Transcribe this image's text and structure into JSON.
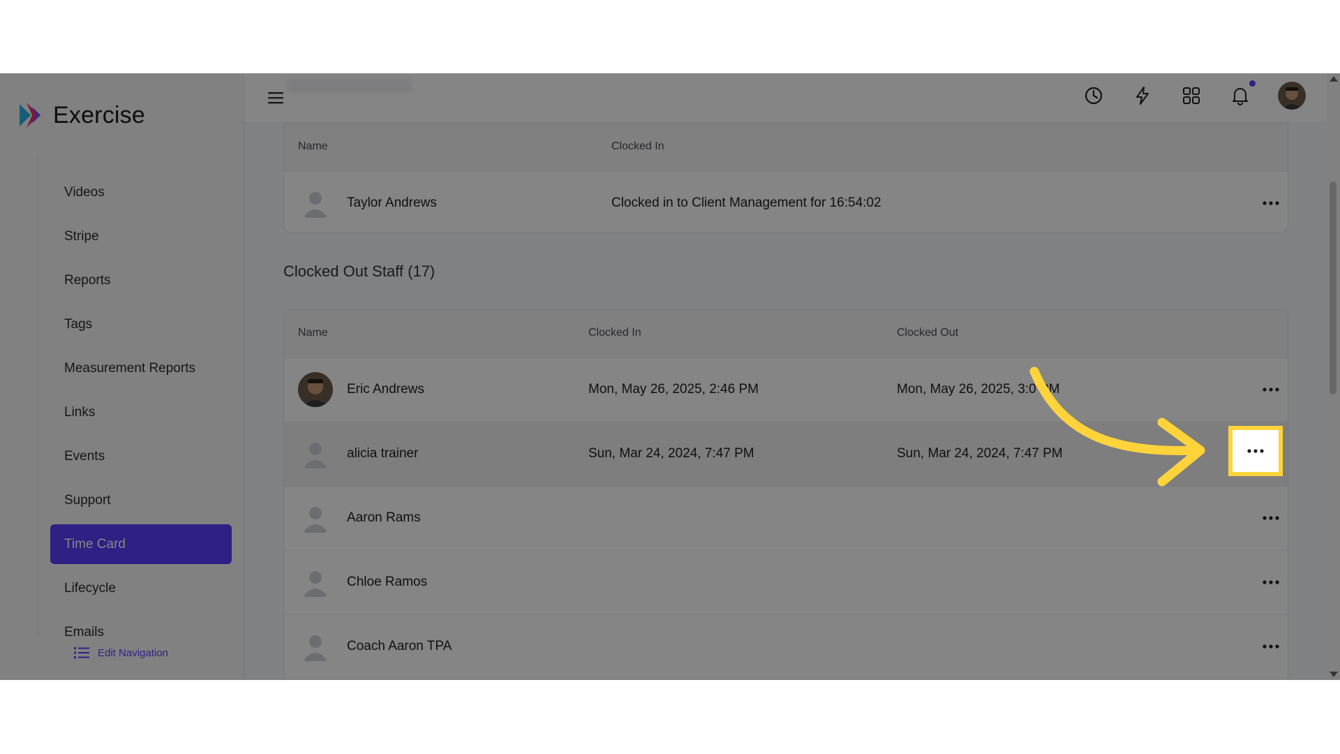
{
  "brand": {
    "name": "Exercise"
  },
  "sidebar": {
    "items": [
      {
        "label": "Videos",
        "active": false
      },
      {
        "label": "Stripe",
        "active": false
      },
      {
        "label": "Reports",
        "active": false
      },
      {
        "label": "Tags",
        "active": false
      },
      {
        "label": "Measurement Reports",
        "active": false
      },
      {
        "label": "Links",
        "active": false
      },
      {
        "label": "Events",
        "active": false
      },
      {
        "label": "Support",
        "active": false
      },
      {
        "label": "Time Card",
        "active": true
      },
      {
        "label": "Lifecycle",
        "active": false
      },
      {
        "label": "Emails",
        "active": false
      }
    ],
    "edit_navigation": "Edit Navigation"
  },
  "topbar": {
    "icons": [
      "history-icon",
      "bolt-icon",
      "apps-grid-icon",
      "bell-icon"
    ]
  },
  "clocked_in": {
    "columns": {
      "name": "Name",
      "clocked_in": "Clocked In"
    },
    "rows": [
      {
        "name": "Taylor Andrews",
        "status": "Clocked in to Client Management for 16:54:02"
      }
    ]
  },
  "clocked_out": {
    "title": "Clocked Out Staff (17)",
    "columns": {
      "name": "Name",
      "clocked_in": "Clocked In",
      "clocked_out": "Clocked Out"
    },
    "rows": [
      {
        "name": "Eric Andrews",
        "clocked_in": "Mon, May 26, 2025, 2:46 PM",
        "clocked_out": "Mon, May 26, 2025, 3:0 PM",
        "photo": true
      },
      {
        "name": "alicia trainer",
        "clocked_in": "Sun, Mar 24, 2024, 7:47 PM",
        "clocked_out": "Sun, Mar 24, 2024, 7:47 PM",
        "photo": false,
        "highlight": true
      },
      {
        "name": "Aaron Rams",
        "clocked_in": "",
        "clocked_out": "",
        "photo": false
      },
      {
        "name": "Chloe Ramos",
        "clocked_in": "",
        "clocked_out": "",
        "photo": false
      },
      {
        "name": "Coach Aaron TPA",
        "clocked_in": "",
        "clocked_out": "",
        "photo": false
      }
    ]
  },
  "colors": {
    "accent": "#5b3fff",
    "annotation": "#ffd43b"
  }
}
